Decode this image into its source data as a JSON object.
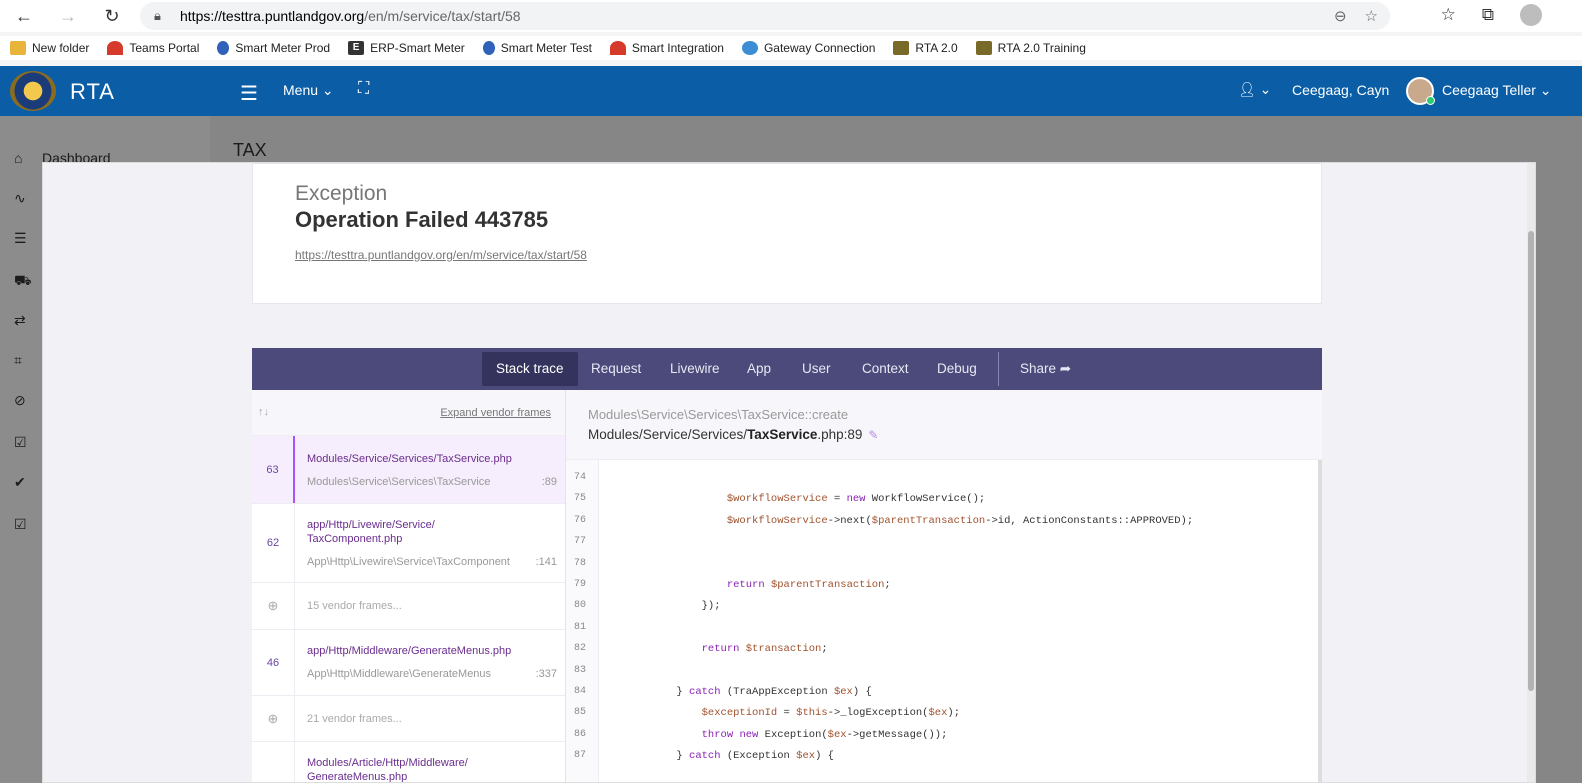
{
  "browser": {
    "url_scheme_host": "https://testtra.puntlandgov.org",
    "url_path": "/en/m/service/tax/start/58"
  },
  "bookmarks": [
    {
      "label": "New folder",
      "icon": "folder-icon"
    },
    {
      "label": "Teams Portal",
      "icon": "teams-portal-icon"
    },
    {
      "label": "Smart Meter Prod",
      "icon": "water-drop-icon"
    },
    {
      "label": "ERP-Smart Meter",
      "icon": "erp-e-icon"
    },
    {
      "label": "Smart Meter Test",
      "icon": "water-drop-icon"
    },
    {
      "label": "Smart Integration",
      "icon": "smart-integration-icon"
    },
    {
      "label": "Gateway Connection",
      "icon": "gateway-icon"
    },
    {
      "label": "RTA 2.0",
      "icon": "crest-icon"
    },
    {
      "label": "RTA 2.0 Training",
      "icon": "crest-icon"
    }
  ],
  "header": {
    "brand": "RTA",
    "menu_label": "Menu",
    "user_name": "Ceegaag, Cayn",
    "teller_name": "Ceegaag Teller"
  },
  "sidebar": {
    "dashboard_label": "Dashboard"
  },
  "page": {
    "title": "TAX"
  },
  "exception": {
    "type": "Exception",
    "message": "Operation Failed 443785",
    "url": "https://testtra.puntlandgov.org/en/m/service/tax/start/58"
  },
  "trace_tabs": [
    "Stack trace",
    "Request",
    "Livewire",
    "App",
    "User",
    "Context",
    "Debug"
  ],
  "share_label": "Share",
  "frames_panel": {
    "expand_label": "Expand vendor frames",
    "frames": [
      {
        "kind": "app",
        "num": "63",
        "file": "Modules/Service/Services/TaxService.php",
        "cls": "Modules\\Service\\Services\\TaxService",
        "line": ":89"
      },
      {
        "kind": "app",
        "num": "62",
        "file": "app/Http/Livewire/Service/\nTaxComponent.php",
        "cls": "App\\Http\\Livewire\\Service\\TaxComponent",
        "line": ":141"
      },
      {
        "kind": "vendor",
        "text": "15 vendor frames..."
      },
      {
        "kind": "app",
        "num": "46",
        "file": "app/Http/Middleware/GenerateMenus.php",
        "cls": "App\\Http\\Middleware\\GenerateMenus",
        "line": ":337"
      },
      {
        "kind": "vendor",
        "text": "21 vendor frames..."
      },
      {
        "kind": "app",
        "num": "",
        "file": "Modules/Article/Http/Middleware/\nGenerateMenus.php",
        "cls": "",
        "line": ""
      }
    ]
  },
  "code": {
    "class_method": "Modules\\Service\\Services\\TaxService::create",
    "file_prefix": "Modules/Service/Services/",
    "file_name": "TaxService",
    "file_suffix": ".php:89",
    "lines": [
      {
        "n": "74",
        "text": ""
      },
      {
        "n": "75",
        "text": "                $workflowService = new WorkflowService();"
      },
      {
        "n": "76",
        "text": "                $workflowService->next($parentTransaction->id, ActionConstants::APPROVED);"
      },
      {
        "n": "77",
        "text": ""
      },
      {
        "n": "78",
        "text": ""
      },
      {
        "n": "79",
        "text": "                return $parentTransaction;"
      },
      {
        "n": "80",
        "text": "            });"
      },
      {
        "n": "81",
        "text": ""
      },
      {
        "n": "82",
        "text": "            return $transaction;"
      },
      {
        "n": "83",
        "text": ""
      },
      {
        "n": "84",
        "text": "        } catch (TraAppException $ex) {"
      },
      {
        "n": "85",
        "text": "            $exceptionId = $this->_logException($ex);"
      },
      {
        "n": "86",
        "text": "            throw new Exception($ex->getMessage());"
      },
      {
        "n": "87",
        "text": "        } catch (Exception $ex) {"
      }
    ]
  }
}
